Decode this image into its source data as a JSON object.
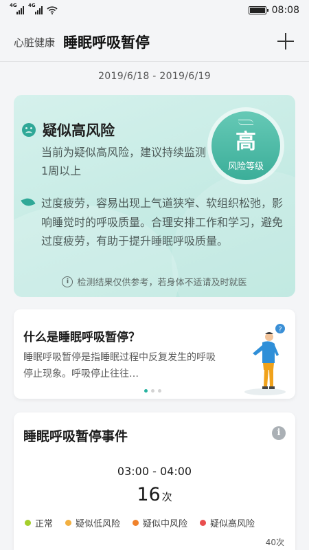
{
  "status_bar": {
    "time": "08:08",
    "signal_tag_1": "4G",
    "signal_tag_2": "4G"
  },
  "header": {
    "back_title": "心脏健康",
    "title": "睡眠呼吸暂停",
    "add_icon": "plus-icon"
  },
  "date_range": "2019/6/18  -  2019/6/19",
  "risk": {
    "title": "疑似高风险",
    "subtitle": "当前为疑似高风险，建议持续监测1周以上",
    "level": "高",
    "level_label": "风险等级",
    "advice": "过度疲劳，容易出现上气道狭窄、软组织松弛，影响睡觉时的呼吸质量。合理安排工作和学习，避免过度疲劳，有助于提升睡眠呼吸质量。",
    "disclaimer": "检测结果仅供参考，若身体不适请及时就医",
    "info_glyph": "i",
    "colors": {
      "accent": "#2fa897",
      "card_bg": "#c9ece5"
    }
  },
  "knowledge": {
    "title": "什么是睡眠呼吸暂停？",
    "body": "睡眠呼吸暂停是指睡眠过程中反复发生的呼吸停止现象。呼吸停止往往…",
    "carousel_pages": 3,
    "active_page": 1,
    "bubble": "?"
  },
  "events": {
    "title": "睡眠呼吸暂停事件",
    "info_glyph": "i",
    "time_range": "03:00 - 04:00",
    "count": "16",
    "count_unit": "次",
    "legend": [
      {
        "label": "正常",
        "color": "#a5cf2b"
      },
      {
        "label": "疑似低风险",
        "color": "#f2b041"
      },
      {
        "label": "疑似中风险",
        "color": "#f0822b"
      },
      {
        "label": "疑似高风险",
        "color": "#e94e4e"
      }
    ],
    "axis_max_label": "40次"
  }
}
